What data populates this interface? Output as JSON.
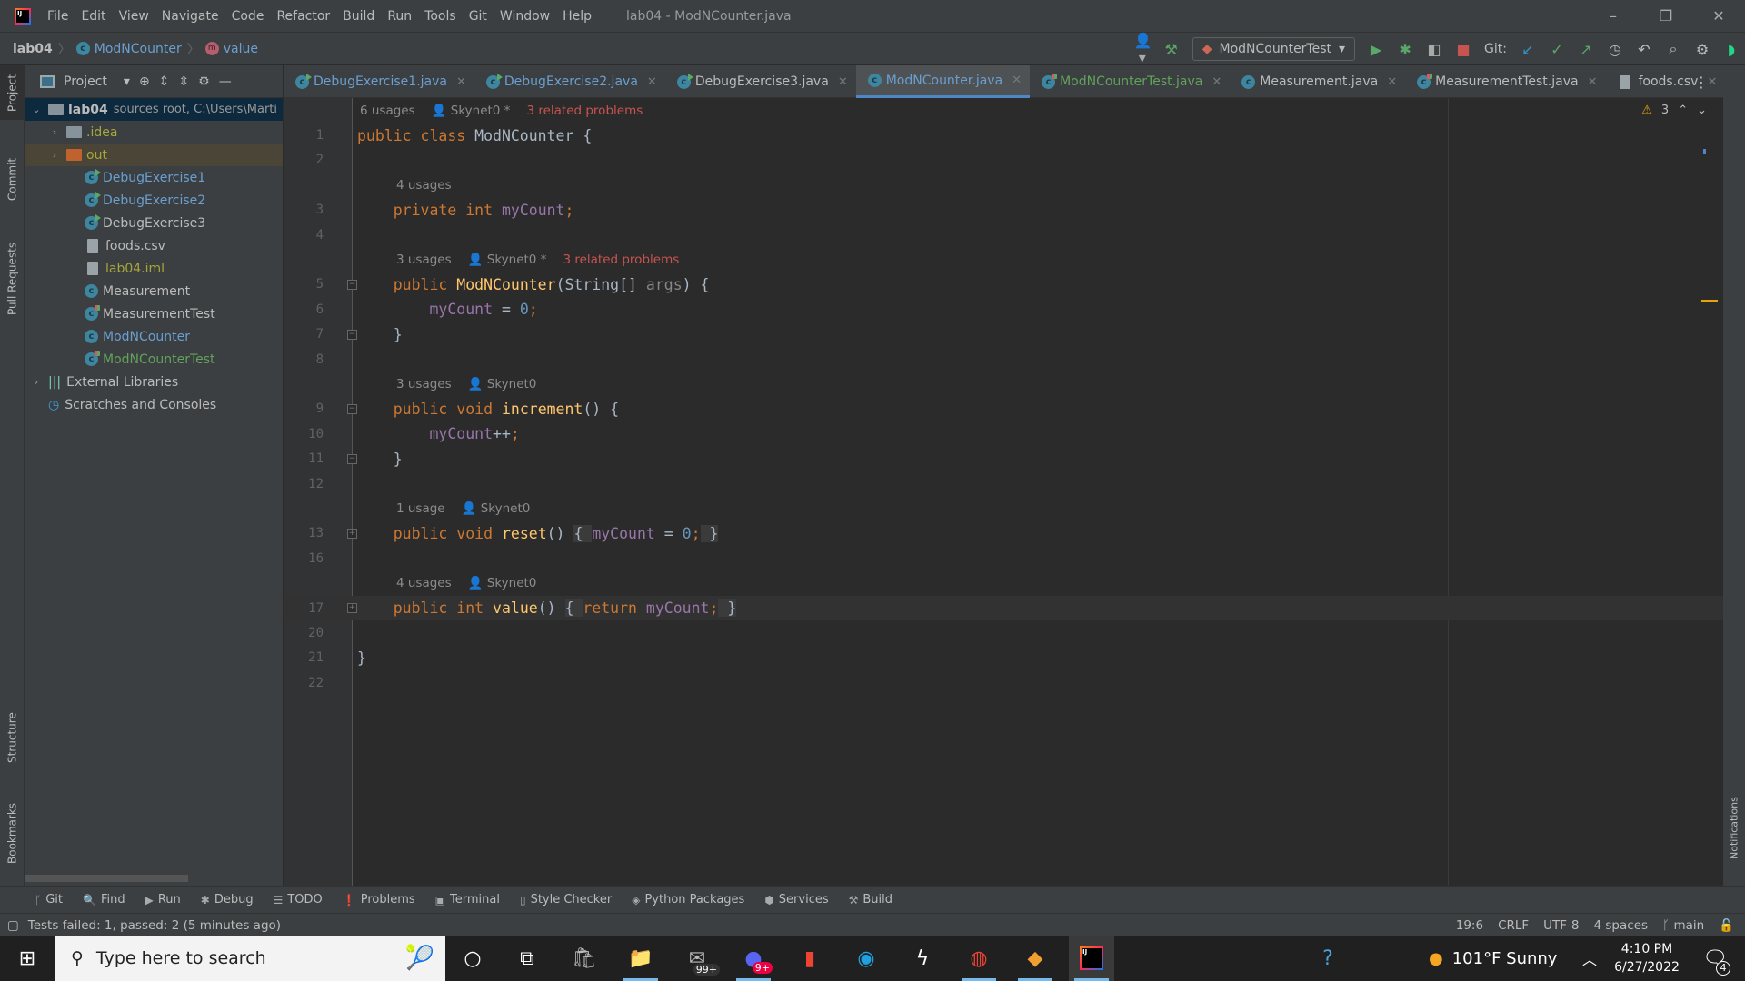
{
  "window": {
    "title": "lab04 - ModNCounter.java",
    "menu": [
      "File",
      "Edit",
      "View",
      "Navigate",
      "Code",
      "Refactor",
      "Build",
      "Run",
      "Tools",
      "Git",
      "Window",
      "Help"
    ],
    "controls": [
      "–",
      "❐",
      "✕"
    ]
  },
  "breadcrumb": {
    "project": "lab04",
    "class": "ModNCounter",
    "method": "value"
  },
  "toolbar": {
    "run_config": "ModNCounterTest",
    "git_label": "Git:"
  },
  "left_strip": [
    "Project",
    "Commit",
    "Pull Requests",
    "Structure",
    "Bookmarks"
  ],
  "right_strip": [
    "Notifications"
  ],
  "project_panel": {
    "title": "Project",
    "tree": [
      {
        "label": "lab04",
        "suffix": "sources root,  C:\\Users\\Marti",
        "kind": "root",
        "depth": 0,
        "arrow": "⌄",
        "color": "#bbbbbb"
      },
      {
        "label": ".idea",
        "kind": "folder",
        "depth": 1,
        "arrow": "›",
        "color": "#a6a63a"
      },
      {
        "label": "out",
        "kind": "folder-out",
        "depth": 1,
        "arrow": "›",
        "color": "#a6a63a"
      },
      {
        "label": "DebugExercise1",
        "kind": "class-run",
        "depth": 2,
        "color": "#6a9fd0"
      },
      {
        "label": "DebugExercise2",
        "kind": "class-run",
        "depth": 2,
        "color": "#6a9fd0"
      },
      {
        "label": "DebugExercise3",
        "kind": "class-run",
        "depth": 2,
        "color": "#bbbbbb"
      },
      {
        "label": "foods.csv",
        "kind": "file",
        "depth": 2,
        "color": "#bbbbbb"
      },
      {
        "label": "lab04.iml",
        "kind": "file",
        "depth": 2,
        "color": "#a6a63a"
      },
      {
        "label": "Measurement",
        "kind": "class",
        "depth": 2,
        "color": "#bbbbbb"
      },
      {
        "label": "MeasurementTest",
        "kind": "class-test",
        "depth": 2,
        "color": "#bbbbbb"
      },
      {
        "label": "ModNCounter",
        "kind": "class",
        "depth": 2,
        "color": "#6a9fd0"
      },
      {
        "label": "ModNCounterTest",
        "kind": "class-test",
        "depth": 2,
        "color": "#62a35c"
      },
      {
        "label": "External Libraries",
        "kind": "lib",
        "depth": 0,
        "arrow": "›",
        "color": "#bbbbbb"
      },
      {
        "label": "Scratches and Consoles",
        "kind": "scratch",
        "depth": 0,
        "color": "#bbbbbb"
      }
    ]
  },
  "tabs": [
    {
      "label": "DebugExercise1.java",
      "kind": "class-run",
      "color": "#6a9fd0"
    },
    {
      "label": "DebugExercise2.java",
      "kind": "class-run",
      "color": "#6a9fd0"
    },
    {
      "label": "DebugExercise3.java",
      "kind": "class-run",
      "color": "#bbbbbb"
    },
    {
      "label": "ModNCounter.java",
      "kind": "class",
      "color": "#6a9fd0",
      "active": true
    },
    {
      "label": "ModNCounterTest.java",
      "kind": "class-test",
      "color": "#62a35c"
    },
    {
      "label": "Measurement.java",
      "kind": "class",
      "color": "#bbbbbb"
    },
    {
      "label": "MeasurementTest.java",
      "kind": "class-test",
      "color": "#bbbbbb"
    },
    {
      "label": "foods.csv",
      "kind": "file",
      "color": "#bbbbbb"
    }
  ],
  "editor": {
    "warnings": "3",
    "rows": [
      {
        "inlay": [
          "6 usages",
          "👤 Skynet0 *"
        ],
        "problems": "3 related problems",
        "indent": 0
      },
      {
        "num": "1",
        "tokens": [
          [
            "public class ",
            "kw"
          ],
          [
            "ModNCounter {",
            ""
          ]
        ]
      },
      {
        "num": "2",
        "tokens": []
      },
      {
        "inlay": [
          "4 usages"
        ],
        "indent": 1
      },
      {
        "num": "3",
        "tokens": [
          [
            "    private int ",
            "kw"
          ],
          [
            "myCount",
            "fld"
          ],
          [
            ";",
            "kw"
          ]
        ]
      },
      {
        "num": "4",
        "tokens": []
      },
      {
        "inlay": [
          "3 usages",
          "👤 Skynet0 *"
        ],
        "problems": "3 related problems",
        "indent": 1
      },
      {
        "num": "5",
        "fold": "⌄",
        "tokens": [
          [
            "    public ",
            "kw"
          ],
          [
            "ModNCounter",
            "mth"
          ],
          [
            "(String[] ",
            ""
          ],
          [
            "args",
            "prm"
          ],
          [
            ") {",
            ""
          ]
        ]
      },
      {
        "num": "6",
        "tokens": [
          [
            "        myCount",
            "fld"
          ],
          [
            " = ",
            ""
          ],
          [
            "0",
            "num"
          ],
          [
            ";",
            "kw"
          ]
        ]
      },
      {
        "num": "7",
        "fold": "⌃",
        "tokens": [
          [
            "    }",
            ""
          ]
        ]
      },
      {
        "num": "8",
        "tokens": []
      },
      {
        "inlay": [
          "3 usages",
          "👤 Skynet0"
        ],
        "indent": 1
      },
      {
        "num": "9",
        "fold": "⌄",
        "tokens": [
          [
            "    public void ",
            "kw"
          ],
          [
            "increment",
            "mth"
          ],
          [
            "() {",
            ""
          ]
        ]
      },
      {
        "num": "10",
        "tokens": [
          [
            "        myCount",
            "fld"
          ],
          [
            "++",
            ""
          ],
          [
            ";",
            "kw"
          ]
        ]
      },
      {
        "num": "11",
        "fold": "⌃",
        "tokens": [
          [
            "    }",
            ""
          ]
        ]
      },
      {
        "num": "12",
        "tokens": []
      },
      {
        "inlay": [
          "1 usage",
          "👤 Skynet0"
        ],
        "indent": 1
      },
      {
        "num": "13",
        "fold": "+",
        "tokens": [
          [
            "    public void ",
            "kw"
          ],
          [
            "reset",
            "mth"
          ],
          [
            "() ",
            ""
          ],
          [
            "{ ",
            "fold"
          ],
          [
            "myCount",
            "fld"
          ],
          [
            " = ",
            ""
          ],
          [
            "0",
            "num"
          ],
          [
            ";",
            "kw"
          ],
          [
            " }",
            "fold"
          ]
        ]
      },
      {
        "num": "16",
        "tokens": []
      },
      {
        "inlay": [
          "4 usages",
          "👤 Skynet0"
        ],
        "indent": 1
      },
      {
        "num": "17",
        "fold": "+",
        "current": true,
        "tokens": [
          [
            "    public int ",
            "kw"
          ],
          [
            "value",
            "mth"
          ],
          [
            "() ",
            ""
          ],
          [
            "{ ",
            "fold"
          ],
          [
            "return ",
            "kw"
          ],
          [
            "myCount",
            "fld"
          ],
          [
            ";",
            "kw"
          ],
          [
            " }",
            "fold"
          ]
        ]
      },
      {
        "num": "20",
        "tokens": []
      },
      {
        "num": "21",
        "tokens": [
          [
            "}",
            ""
          ]
        ]
      },
      {
        "num": "22",
        "tokens": []
      }
    ]
  },
  "bottom_tools": [
    {
      "icon": "git-icon",
      "glyph": "ᚴ",
      "label": "Git"
    },
    {
      "icon": "search-icon",
      "glyph": "🔍",
      "label": "Find"
    },
    {
      "icon": "run-icon",
      "glyph": "▶",
      "label": "Run"
    },
    {
      "icon": "debug-icon",
      "glyph": "✱",
      "label": "Debug"
    },
    {
      "icon": "todo-icon",
      "glyph": "☰",
      "label": "TODO"
    },
    {
      "icon": "problems-icon",
      "glyph": "❗",
      "label": "Problems"
    },
    {
      "icon": "terminal-icon",
      "glyph": "▣",
      "label": "Terminal"
    },
    {
      "icon": "style-checker-icon",
      "glyph": "▯",
      "label": "Style Checker"
    },
    {
      "icon": "python-packages-icon",
      "glyph": "◈",
      "label": "Python Packages"
    },
    {
      "icon": "services-icon",
      "glyph": "⬢",
      "label": "Services"
    },
    {
      "icon": "build-icon",
      "glyph": "⚒",
      "label": "Build"
    }
  ],
  "status": {
    "message": "Tests failed: 1, passed: 2 (5 minutes ago)",
    "position": "19:6",
    "line_ending": "CRLF",
    "encoding": "UTF-8",
    "indent": "4 spaces",
    "branch": "main"
  },
  "taskbar": {
    "search_placeholder": "Type here to search",
    "mail_badge": "99+",
    "discord_badge": "9+",
    "weather": "101°F  Sunny",
    "time": "4:10 PM",
    "date": "6/27/2022",
    "notifications": "4"
  }
}
